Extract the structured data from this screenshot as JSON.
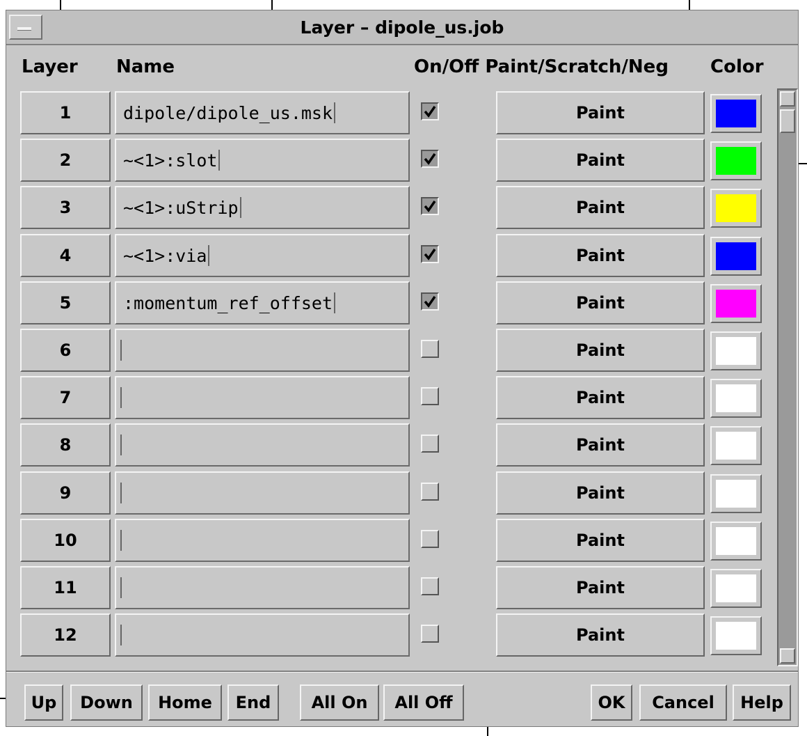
{
  "window": {
    "title": "Layer – dipole_us.job"
  },
  "headers": {
    "layer": "Layer",
    "name": "Name",
    "onoff_mode": "On/Off Paint/Scratch/Neg",
    "color": "Color"
  },
  "rows": [
    {
      "num": "1",
      "name": "dipole/dipole_us.msk",
      "on": true,
      "mode": "Paint",
      "color": "#0000ff"
    },
    {
      "num": "2",
      "name": "~<1>:slot",
      "on": true,
      "mode": "Paint",
      "color": "#00ff00"
    },
    {
      "num": "3",
      "name": "~<1>:uStrip",
      "on": true,
      "mode": "Paint",
      "color": "#ffff00"
    },
    {
      "num": "4",
      "name": "~<1>:via",
      "on": true,
      "mode": "Paint",
      "color": "#0000ff"
    },
    {
      "num": "5",
      "name": ":momentum_ref_offset",
      "on": true,
      "mode": "Paint",
      "color": "#ff00ff"
    },
    {
      "num": "6",
      "name": "",
      "on": false,
      "mode": "Paint",
      "color": "#ffffff"
    },
    {
      "num": "7",
      "name": "",
      "on": false,
      "mode": "Paint",
      "color": "#ffffff"
    },
    {
      "num": "8",
      "name": "",
      "on": false,
      "mode": "Paint",
      "color": "#ffffff"
    },
    {
      "num": "9",
      "name": "",
      "on": false,
      "mode": "Paint",
      "color": "#ffffff"
    },
    {
      "num": "10",
      "name": "",
      "on": false,
      "mode": "Paint",
      "color": "#ffffff"
    },
    {
      "num": "11",
      "name": "",
      "on": false,
      "mode": "Paint",
      "color": "#ffffff"
    },
    {
      "num": "12",
      "name": "",
      "on": false,
      "mode": "Paint",
      "color": "#ffffff"
    }
  ],
  "buttons": {
    "up": "Up",
    "down": "Down",
    "home": "Home",
    "end": "End",
    "all_on": "All On",
    "all_off": "All Off",
    "ok": "OK",
    "cancel": "Cancel",
    "help": "Help"
  }
}
